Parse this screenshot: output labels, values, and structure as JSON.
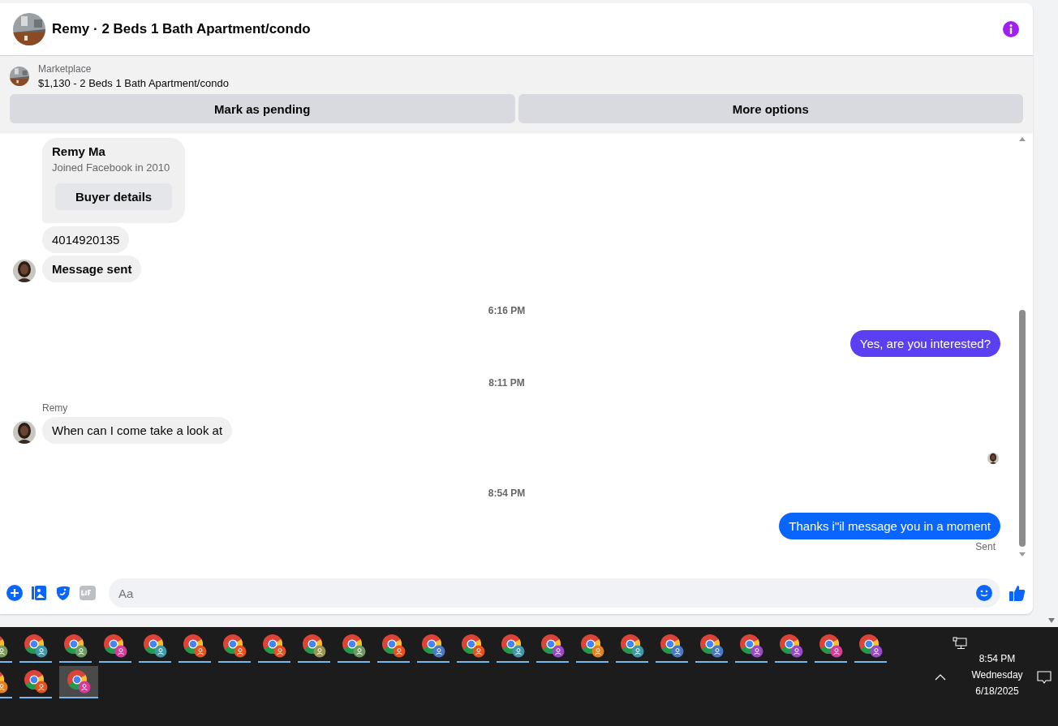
{
  "header": {
    "title": "Remy · 2 Beds 1 Bath Apartment/condo"
  },
  "listing": {
    "source": "Marketplace",
    "summary": "$1,130 - 2 Beds 1 Bath Apartment/condo",
    "actions": [
      "Mark as pending",
      "More options"
    ]
  },
  "messages": [
    {
      "kind": "card",
      "name": "Remy Ma",
      "detail": "Joined Facebook in 2010",
      "button": "Buyer details"
    },
    {
      "kind": "incoming",
      "text": "4014920135",
      "avatar": false,
      "bold": false
    },
    {
      "kind": "incoming",
      "text": "Message sent",
      "avatar": true,
      "bold": true
    },
    {
      "kind": "time",
      "text": "6:16 PM"
    },
    {
      "kind": "outgoing",
      "text": "Yes, are you interested?",
      "color": "#5a40f2"
    },
    {
      "kind": "time",
      "text": "8:11 PM"
    },
    {
      "kind": "sender",
      "text": "Remy"
    },
    {
      "kind": "incoming",
      "text": "When can I come take a look at",
      "avatar": true,
      "bold": false
    },
    {
      "kind": "seen"
    },
    {
      "kind": "time",
      "text": "8:54 PM"
    },
    {
      "kind": "outgoing",
      "text": "Thanks i\"il message you in a moment",
      "color": "#0866ff"
    },
    {
      "kind": "status",
      "text": "Sent"
    }
  ],
  "composer": {
    "placeholder": "Aa"
  },
  "taskbar": {
    "rows": [
      [
        {
          "color": "#7e9a5a",
          "selected": false
        },
        {
          "color": "#3f97a8",
          "selected": false
        },
        {
          "color": "#6e9a62",
          "selected": false
        },
        {
          "color": "#d93a98",
          "selected": false
        },
        {
          "color": "#3f97a8",
          "selected": false
        },
        {
          "color": "#e8501e",
          "selected": false
        },
        {
          "color": "#e8501e",
          "selected": false
        },
        {
          "color": "#e8501e",
          "selected": false
        },
        {
          "color": "#9a9450",
          "selected": false
        },
        {
          "color": "#6e9a62",
          "selected": false
        },
        {
          "color": "#e8501e",
          "selected": false
        },
        {
          "color": "#4a78c8",
          "selected": false
        },
        {
          "color": "#e8501e",
          "selected": false
        },
        {
          "color": "#3f97a8",
          "selected": false
        },
        {
          "color": "#9a4ac8",
          "selected": false
        },
        {
          "color": "#e8801e",
          "selected": false
        },
        {
          "color": "#3f97a8",
          "selected": false
        },
        {
          "color": "#4a78c8",
          "selected": false
        },
        {
          "color": "#4a78c8",
          "selected": false
        },
        {
          "color": "#9a4ac8",
          "selected": false
        },
        {
          "color": "#9a4ac8",
          "selected": false
        },
        {
          "color": "#d93a98",
          "selected": false
        },
        {
          "color": "#9a4ac8",
          "selected": false
        }
      ],
      [
        {
          "color": "#e8801e",
          "selected": false
        },
        {
          "color": "#e8501e",
          "selected": false
        },
        {
          "color": "#d93a98",
          "selected": true
        }
      ]
    ],
    "time": "8:54 PM",
    "day": "Wednesday",
    "date": "6/18/2025"
  }
}
